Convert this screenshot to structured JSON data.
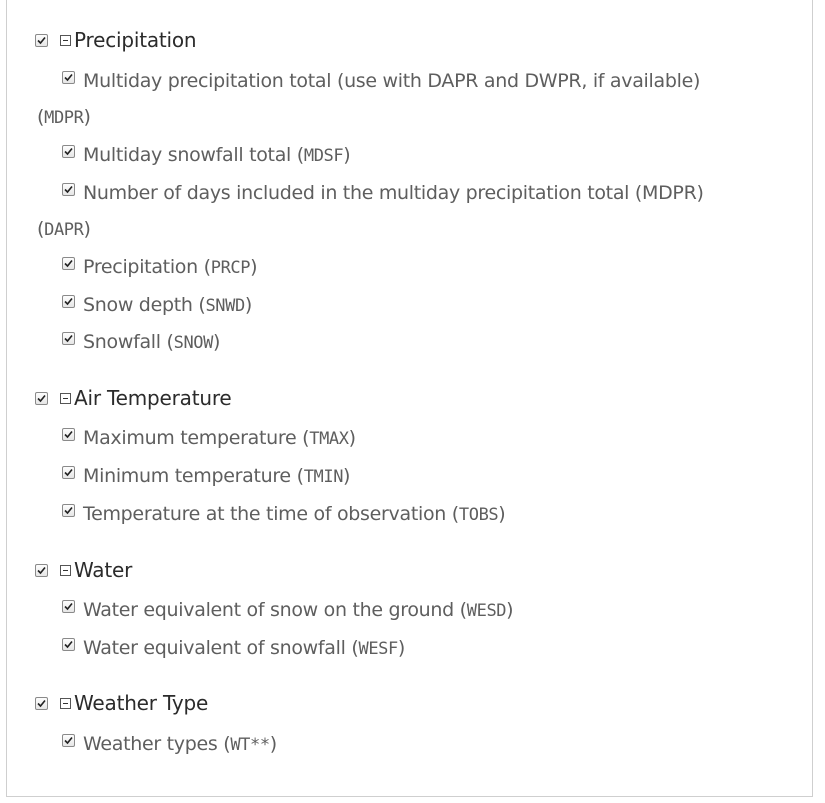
{
  "groups": [
    {
      "label": "Precipitation",
      "checked": true,
      "items": [
        {
          "label": "Multiday precipitation total (use with DAPR and DWPR, if available)",
          "code": "MDPR"
        },
        {
          "label": "Multiday snowfall total",
          "code": "MDSF"
        },
        {
          "label": "Number of days included in the multiday precipitation total (MDPR)",
          "code": "DAPR"
        },
        {
          "label": "Precipitation",
          "code": "PRCP"
        },
        {
          "label": "Snow depth",
          "code": "SNWD"
        },
        {
          "label": "Snowfall",
          "code": "SNOW"
        }
      ]
    },
    {
      "label": "Air Temperature",
      "checked": true,
      "items": [
        {
          "label": "Maximum temperature",
          "code": "TMAX"
        },
        {
          "label": "Minimum temperature",
          "code": "TMIN"
        },
        {
          "label": "Temperature at the time of observation",
          "code": "TOBS"
        }
      ]
    },
    {
      "label": "Water",
      "checked": true,
      "items": [
        {
          "label": "Water equivalent of snow on the ground",
          "code": "WESD"
        },
        {
          "label": "Water equivalent of snowfall",
          "code": "WESF"
        }
      ]
    },
    {
      "label": "Weather Type",
      "checked": true,
      "items": [
        {
          "label": "Weather types",
          "code": "WT**"
        }
      ]
    }
  ],
  "icons": {
    "checkbox": "checkbox-checked-icon",
    "collapse": "minus-box-icon"
  }
}
